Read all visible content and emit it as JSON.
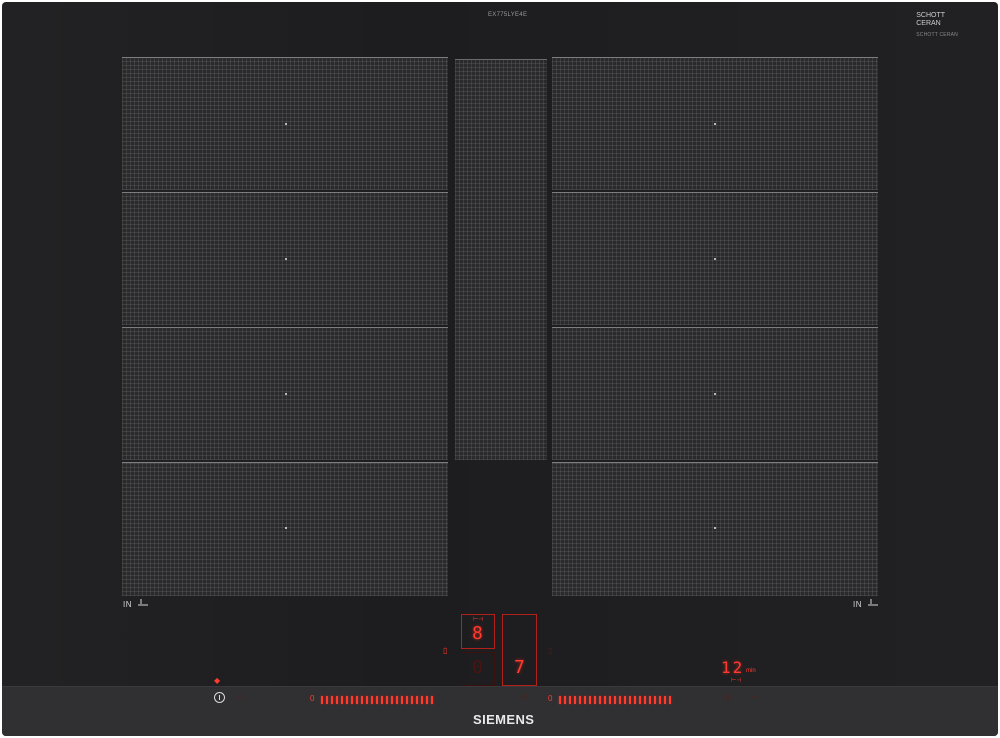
{
  "model_label": "EX775LYE4E",
  "logo": {
    "line1": "SCHOTT",
    "line2": "CERAN",
    "sub": "SCHOTT CERAN"
  },
  "zones": {
    "left_label": "IN",
    "right_label": "IN"
  },
  "display": {
    "top_digit": "8",
    "left_digit": "0",
    "right_digit": "7",
    "timer_value": "12",
    "timer_unit": "min",
    "top_small": "⊢⊣",
    "timer_small": "⊢⊣"
  },
  "slider": {
    "left_zero": "0",
    "right_zero": "0"
  },
  "brand": "SIEMENS",
  "colors": {
    "hob": "#1d1d1f",
    "indicator": "#ff3b2f",
    "zone_grid": "#969696"
  }
}
